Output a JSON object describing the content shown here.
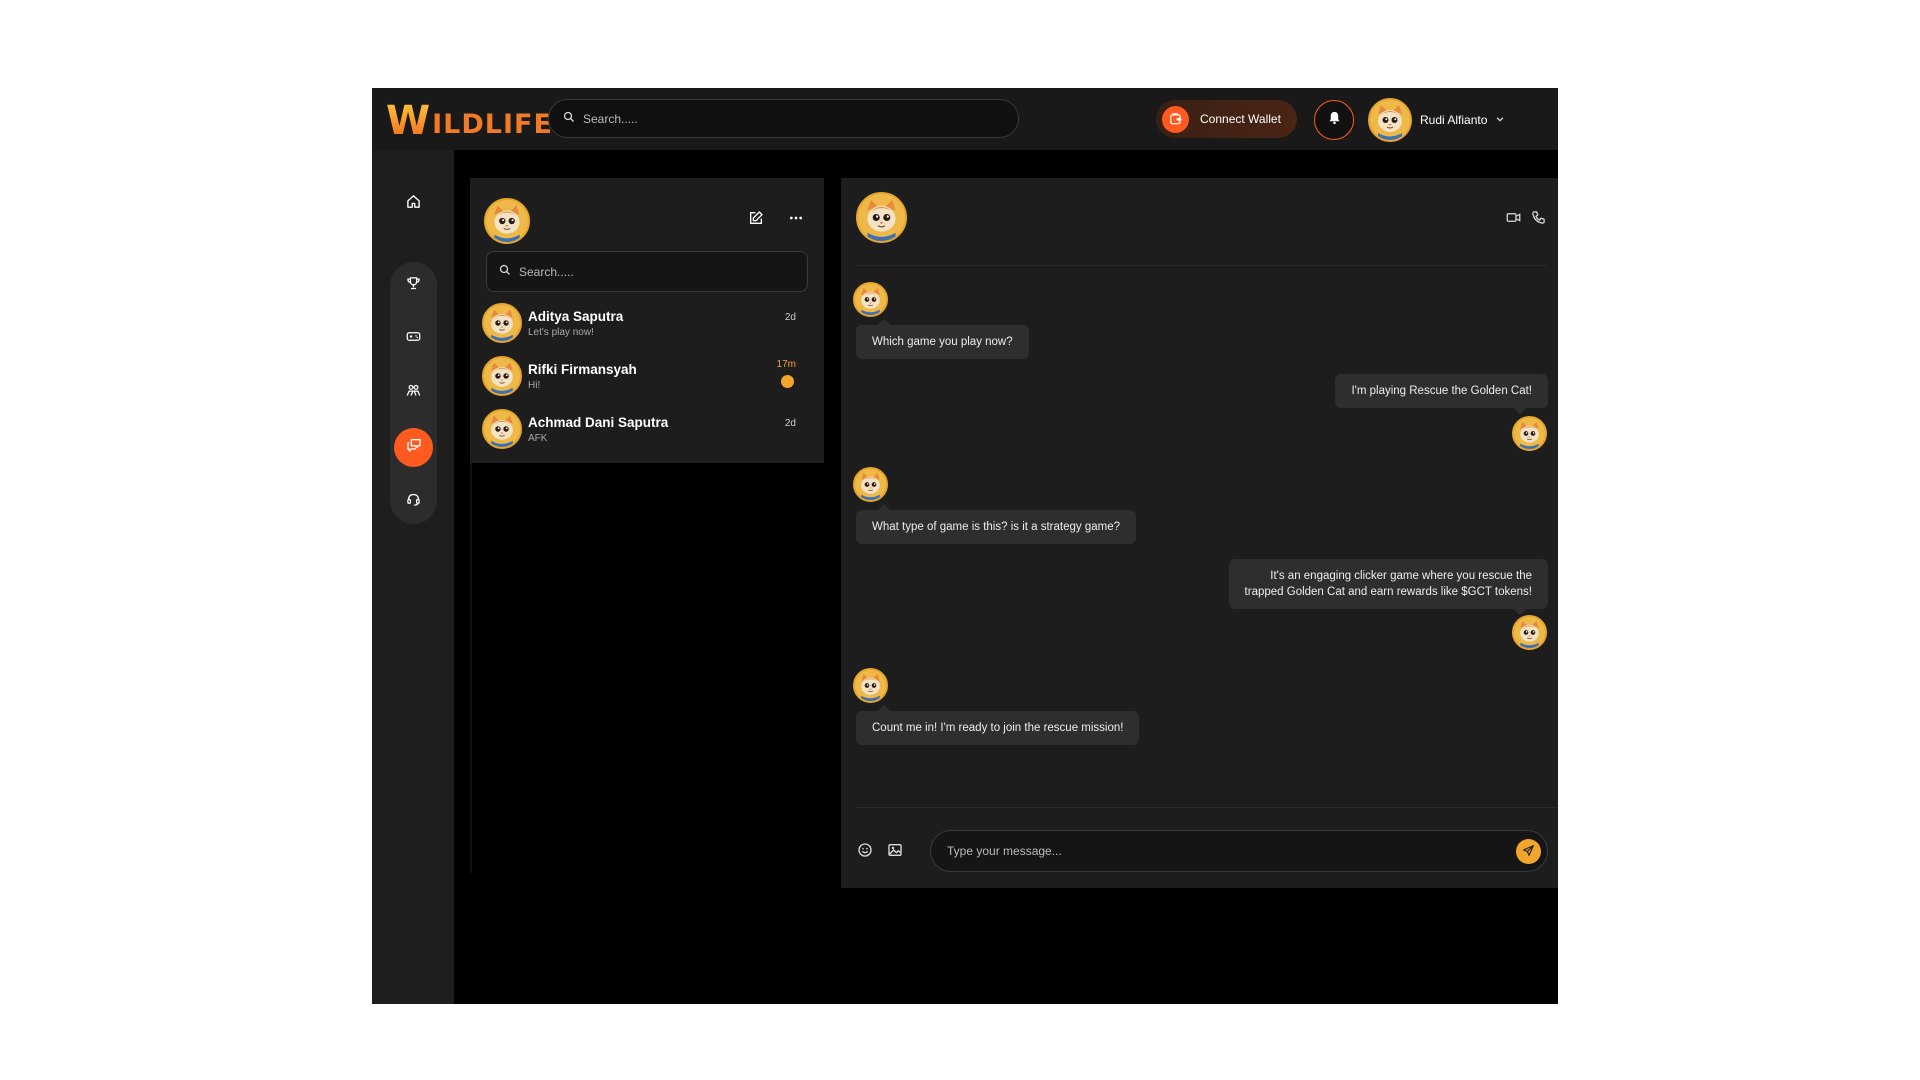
{
  "header": {
    "logo_first_letter": "W",
    "logo_rest": "ILDLIFE",
    "search_placeholder": "Search.....",
    "connect_wallet_label": "Connect Wallet",
    "user_name": "Rudi Alfianto"
  },
  "colors": {
    "accent": "#ff5a1f",
    "gold": "#f2a52b",
    "panel": "#1d1d1d",
    "background": "#000000"
  },
  "sidebar": {
    "items": [
      {
        "icon": "home-icon",
        "active": false
      },
      {
        "icon": "trophy-icon",
        "active": false
      },
      {
        "icon": "gamepad-icon",
        "active": false
      },
      {
        "icon": "community-icon",
        "active": false
      },
      {
        "icon": "chat-icon",
        "active": true
      },
      {
        "icon": "support-icon",
        "active": false
      }
    ]
  },
  "chat_list": {
    "search_placeholder": "Search.....",
    "contacts": [
      {
        "name": "Aditya Saputra",
        "last_message": "Let's play now!",
        "time": "2d",
        "unread": false
      },
      {
        "name": "Rifki Firmansyah",
        "last_message": "Hi!",
        "time": "17m",
        "unread": true
      },
      {
        "name": "Achmad Dani Saputra",
        "last_message": "AFK",
        "time": "2d",
        "unread": false
      }
    ]
  },
  "conversation": {
    "messages": [
      {
        "side": "left",
        "text": "Which game you play now?"
      },
      {
        "side": "right",
        "text": "I'm playing Rescue the Golden Cat!"
      },
      {
        "side": "left",
        "text": "What type of game is this? is it a strategy game?"
      },
      {
        "side": "right",
        "text_line1": "It's an engaging clicker game where you rescue the",
        "text_line2": "trapped Golden Cat and earn rewards like $GCT tokens!"
      },
      {
        "side": "left",
        "text": "Count me in! I'm ready to join the rescue mission!"
      }
    ],
    "composer_placeholder": "Type your message..."
  }
}
